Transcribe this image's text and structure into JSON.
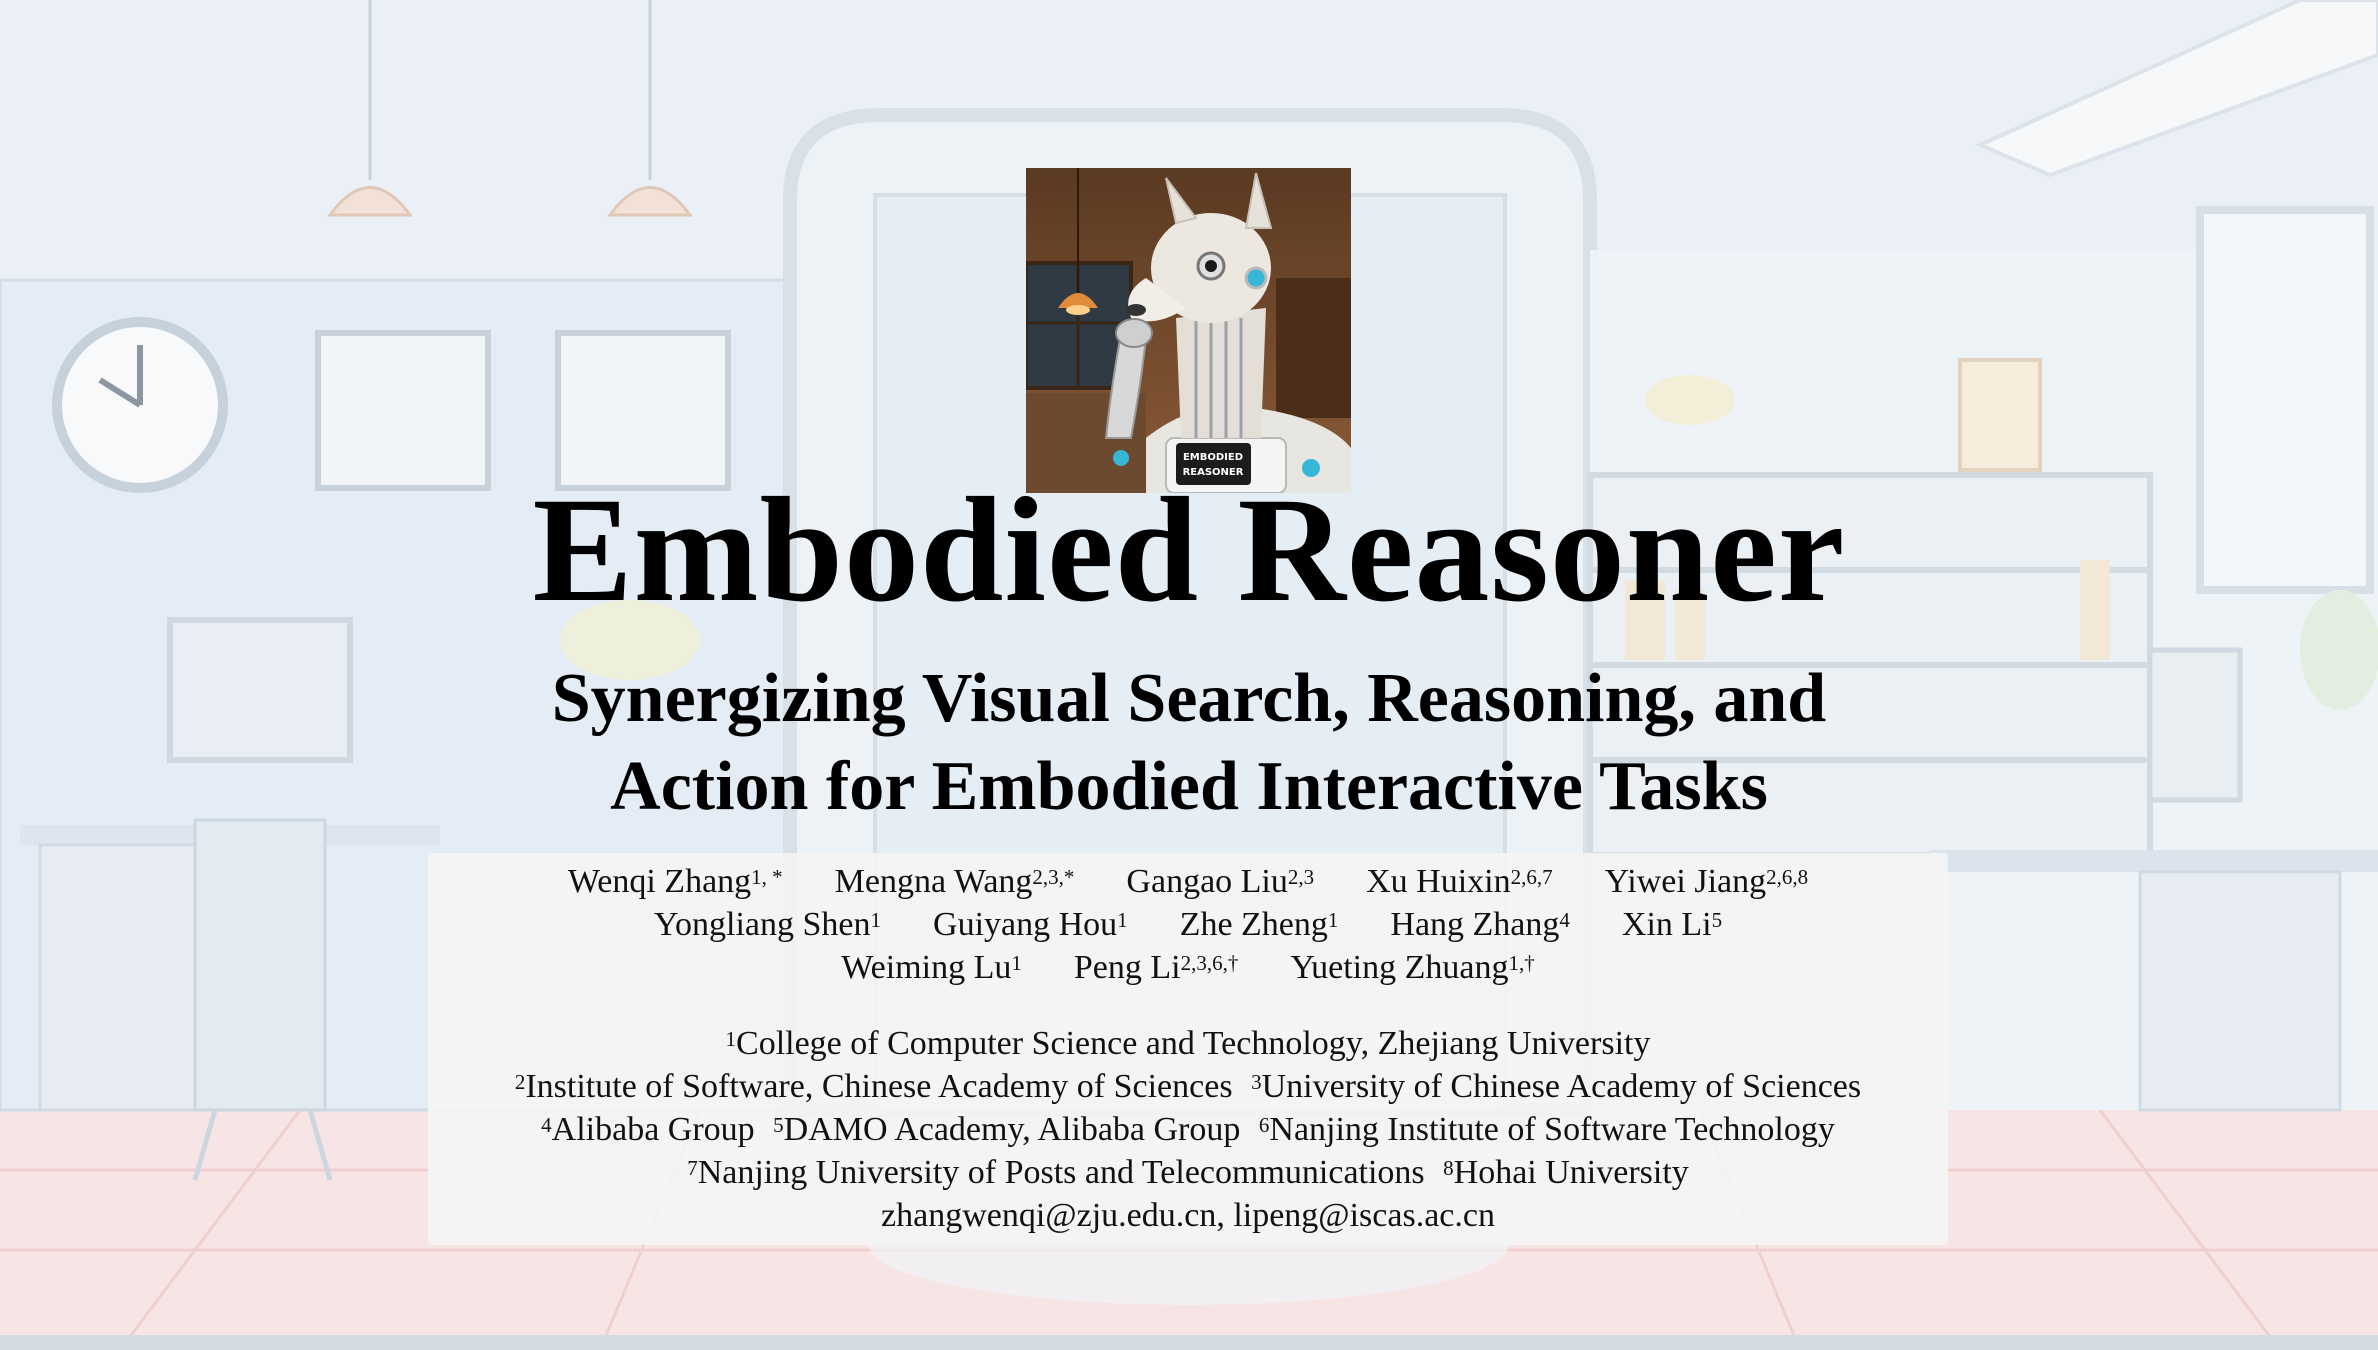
{
  "title": "Embodied Reasoner",
  "subtitle": [
    "Synergizing Visual Search, Reasoning, and",
    "Action for Embodied Interactive Tasks"
  ],
  "logo": {
    "badge_line1": "EMBODIED",
    "badge_line2": "REASONER"
  },
  "authors": [
    [
      {
        "name": "Wenqi Zhang",
        "sup": "1, *"
      },
      {
        "name": "Mengna Wang",
        "sup": "2,3,*"
      },
      {
        "name": "Gangao Liu",
        "sup": "2,3"
      },
      {
        "name": "Xu Huixin",
        "sup": "2,6,7"
      },
      {
        "name": "Yiwei Jiang",
        "sup": "2,6,8"
      }
    ],
    [
      {
        "name": "Yongliang Shen",
        "sup": "1"
      },
      {
        "name": "Guiyang Hou",
        "sup": "1"
      },
      {
        "name": "Zhe Zheng",
        "sup": "1"
      },
      {
        "name": "Hang Zhang",
        "sup": "4"
      },
      {
        "name": "Xin Li",
        "sup": "5"
      }
    ],
    [
      {
        "name": "Weiming Lu",
        "sup": "1"
      },
      {
        "name": "Peng Li",
        "sup": "2,3,6,†"
      },
      {
        "name": "Yueting Zhuang",
        "sup": "1,†"
      }
    ]
  ],
  "affiliations": [
    [
      {
        "sup": "1",
        "text": "College of Computer Science and Technology, Zhejiang University"
      }
    ],
    [
      {
        "sup": "2",
        "text": "Institute of Software, Chinese Academy of Sciences"
      },
      {
        "sup": "3",
        "text": "University of Chinese Academy of Sciences"
      }
    ],
    [
      {
        "sup": "4",
        "text": "Alibaba Group"
      },
      {
        "sup": "5",
        "text": "DAMO Academy, Alibaba Group"
      },
      {
        "sup": "6",
        "text": "Nanjing Institute of Software Technology"
      }
    ],
    [
      {
        "sup": "7",
        "text": "Nanjing University of Posts and Telecommunications"
      },
      {
        "sup": "8",
        "text": "Hohai University"
      }
    ]
  ],
  "emails": "zhangwenqi@zju.edu.cn, lipeng@iscas.ac.cn"
}
